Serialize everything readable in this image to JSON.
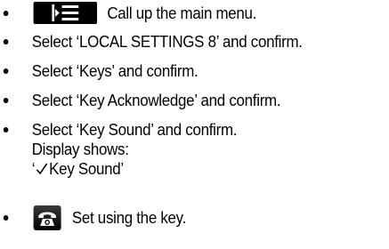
{
  "steps": [
    {
      "icon": "menu-key-icon",
      "text": "Call up the main menu."
    },
    {
      "text": "Select ‘LOCAL SETTINGS 8’ and confirm."
    },
    {
      "text": "Select ‘Keys’ and confirm."
    },
    {
      "text": "Select ‘Key Acknowledge’ and confirm."
    },
    {
      "text": "Select ‘Key Sound’ and confirm.",
      "line2": "Display shows:",
      "line3_prefix": "‘",
      "line3_text": "Key Sound’"
    },
    {
      "icon": "phone-key-icon",
      "text": "Set using the key."
    }
  ]
}
